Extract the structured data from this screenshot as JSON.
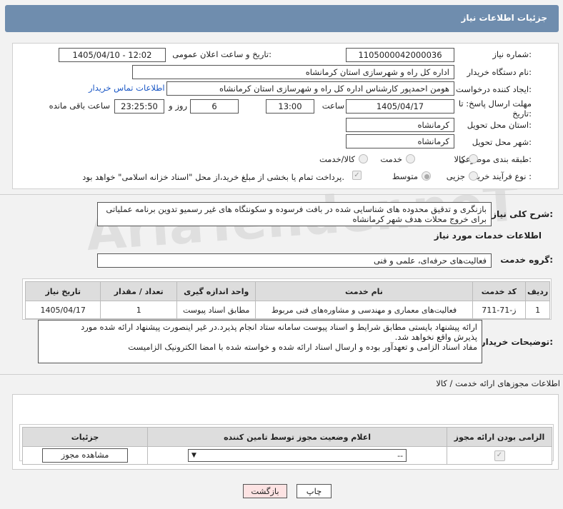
{
  "header": {
    "title": "جزئیات اطلاعات نیاز"
  },
  "fields": {
    "need_number_label": "شماره نیاز:",
    "need_number": "1105000042000036",
    "announce_label": "تاریخ و ساعت اعلان عمومی:",
    "announce_value": "1405/04/10 - 12:02",
    "buyer_org_label": "نام دستگاه خریدار:",
    "buyer_org": "اداره کل راه و شهرسازی استان کرمانشاه",
    "creator_label": "ایجاد کننده درخواست:",
    "creator": "هومن احمدپور کارشناس اداره کل راه و شهرسازی استان کرمانشاه",
    "contact_link": "اطلاعات تماس خریدار",
    "deadline_label_1": "مهلت ارسال پاسخ: تا",
    "deadline_label_2": "تاریخ:",
    "deadline_date": "1405/04/17",
    "time_label": "ساعت",
    "deadline_time": "13:00",
    "days_value": "6",
    "days_label": "روز و",
    "remaining_time": "23:25:50",
    "remaining_label": "ساعت باقی مانده",
    "province_label": "استان محل تحویل:",
    "province": "کرمانشاه",
    "city_label": "شهر محل تحویل:",
    "city": "کرمانشاه",
    "category_label": "طبقه بندی موضوعی:",
    "category_goods": "کالا",
    "category_service": "خدمت",
    "category_both": "کالا/خدمت",
    "process_label": "نوع فرآیند خرید :",
    "process_partial": "جزیی",
    "process_medium": "متوسط",
    "payment_note": "پرداخت تمام یا بخشی از مبلغ خرید،از محل \"اسناد خزانه اسلامی\" خواهد بود."
  },
  "summary": {
    "label": "شرح کلی نیاز:",
    "text": "بازنگری و تدقیق محدوده های شناسایی شده در بافت فرسوده و سکونتگاه های غیر رسمیو تدوین برنامه عملیاتی برای خروج محلات هدف شهر کرمانشاه"
  },
  "services_title": "اطلاعات خدمات مورد نیاز",
  "service_group": {
    "label": "گروه خدمت:",
    "value": "فعالیت‌های حرفه‌ای، علمی و فنی"
  },
  "services_table": {
    "headers": [
      "ردیف",
      "کد خدمت",
      "نام خدمت",
      "واحد اندازه گیری",
      "تعداد / مقدار",
      "تاریخ نیاز"
    ],
    "rows": [
      [
        "1",
        "ز-71-711",
        "فعالیت‌های معماری و مهندسی و مشاوره‌های فنی مربوط",
        "مطابق اسناد پیوست",
        "1",
        "1405/04/17"
      ]
    ]
  },
  "buyer_notes": {
    "label": "توضیحات خریدار:",
    "line1": "ارائه پیشنهاد بایستی مطابق شرایط و اسناد پیوست سامانه ستاد انجام پذیرد.در غیر اینصورت پیشنهاد ارائه شده مورد",
    "line2": "پذیرش واقع نخواهد شد.",
    "line3": "مفاد اسناد الزامی و تعهدآور بوده و ارسال اسناد ارائه شده و خواسته شده با امضا الکترونیک الزامیست"
  },
  "permits": {
    "title": "اطلاعات مجوزهای ارائه خدمت / کالا",
    "headers": [
      "الزامی بودن ارائه مجوز",
      "اعلام وضعیت مجوز توسط تامین کننده",
      "جزئیات"
    ],
    "select_value": "--",
    "view_button": "مشاهده مجوز"
  },
  "buttons": {
    "print": "چاپ",
    "back": "بازگشت"
  },
  "watermark": "AriaTender.neT"
}
